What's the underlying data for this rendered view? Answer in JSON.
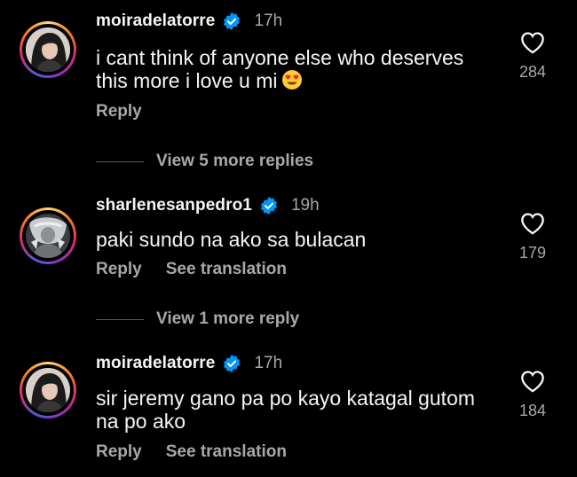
{
  "comments": [
    {
      "username": "moiradelatorre",
      "verified": true,
      "time": "17h",
      "text_lines": [
        "i cant think of anyone else who deserves",
        "this more i love u mi"
      ],
      "emoji": "heart-eyes",
      "actions": {
        "reply": "Reply"
      },
      "likes": "284"
    },
    {
      "username": "sharlenesanpedro1",
      "verified": true,
      "time": "19h",
      "text_lines": [
        "paki sundo na ako sa bulacan"
      ],
      "actions": {
        "reply": "Reply",
        "translate": "See translation"
      },
      "likes": "179"
    },
    {
      "username": "moiradelatorre",
      "verified": true,
      "time": "17h",
      "text_lines": [
        "sir jeremy gano pa po kayo katagal gutom",
        "na po ako"
      ],
      "actions": {
        "reply": "Reply",
        "translate": "See translation"
      },
      "likes": "184"
    }
  ],
  "view_more": [
    "View 5 more replies",
    "View 1 more reply"
  ],
  "colors": {
    "background": "#000000",
    "text": "#f5f5f5",
    "muted": "#a8a8a8",
    "verified": "#0095f6"
  }
}
